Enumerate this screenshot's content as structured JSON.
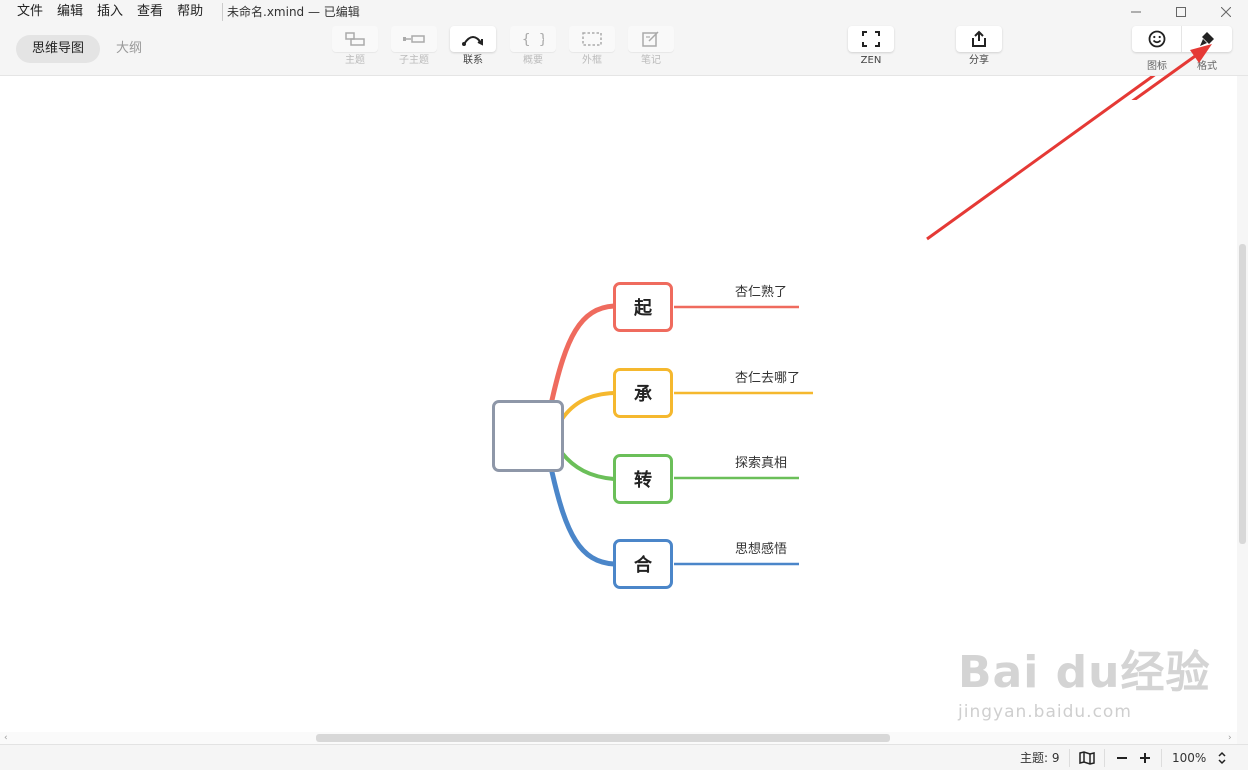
{
  "menu": [
    "文件",
    "编辑",
    "插入",
    "查看",
    "帮助"
  ],
  "document_title": "未命名.xmind — 已编辑",
  "view_tabs": {
    "mindmap": "思维导图",
    "outline": "大纲"
  },
  "toolbar": {
    "topic": "主题",
    "subtopic": "子主题",
    "relationship": "联系",
    "summary": "概要",
    "boundary": "外框",
    "note": "笔记",
    "zen": "ZEN",
    "share": "分享",
    "icon": "图标",
    "format": "格式"
  },
  "mindmap": {
    "central": "",
    "branches": [
      {
        "label": "起",
        "subtopic": "杏仁熟了",
        "color": "#ef6b5e"
      },
      {
        "label": "承",
        "subtopic": "杏仁去哪了",
        "color": "#f5b82e"
      },
      {
        "label": "转",
        "subtopic": "探索真相",
        "color": "#6bbf59"
      },
      {
        "label": "合",
        "subtopic": "思想感悟",
        "color": "#4b86c9"
      }
    ]
  },
  "annotation_arrow_color": "#e53935",
  "watermark": {
    "main": "Bai du经验",
    "sub": "jingyan.baidu.com"
  },
  "status": {
    "topic_count": "主题: 9",
    "zoom": "100%"
  }
}
